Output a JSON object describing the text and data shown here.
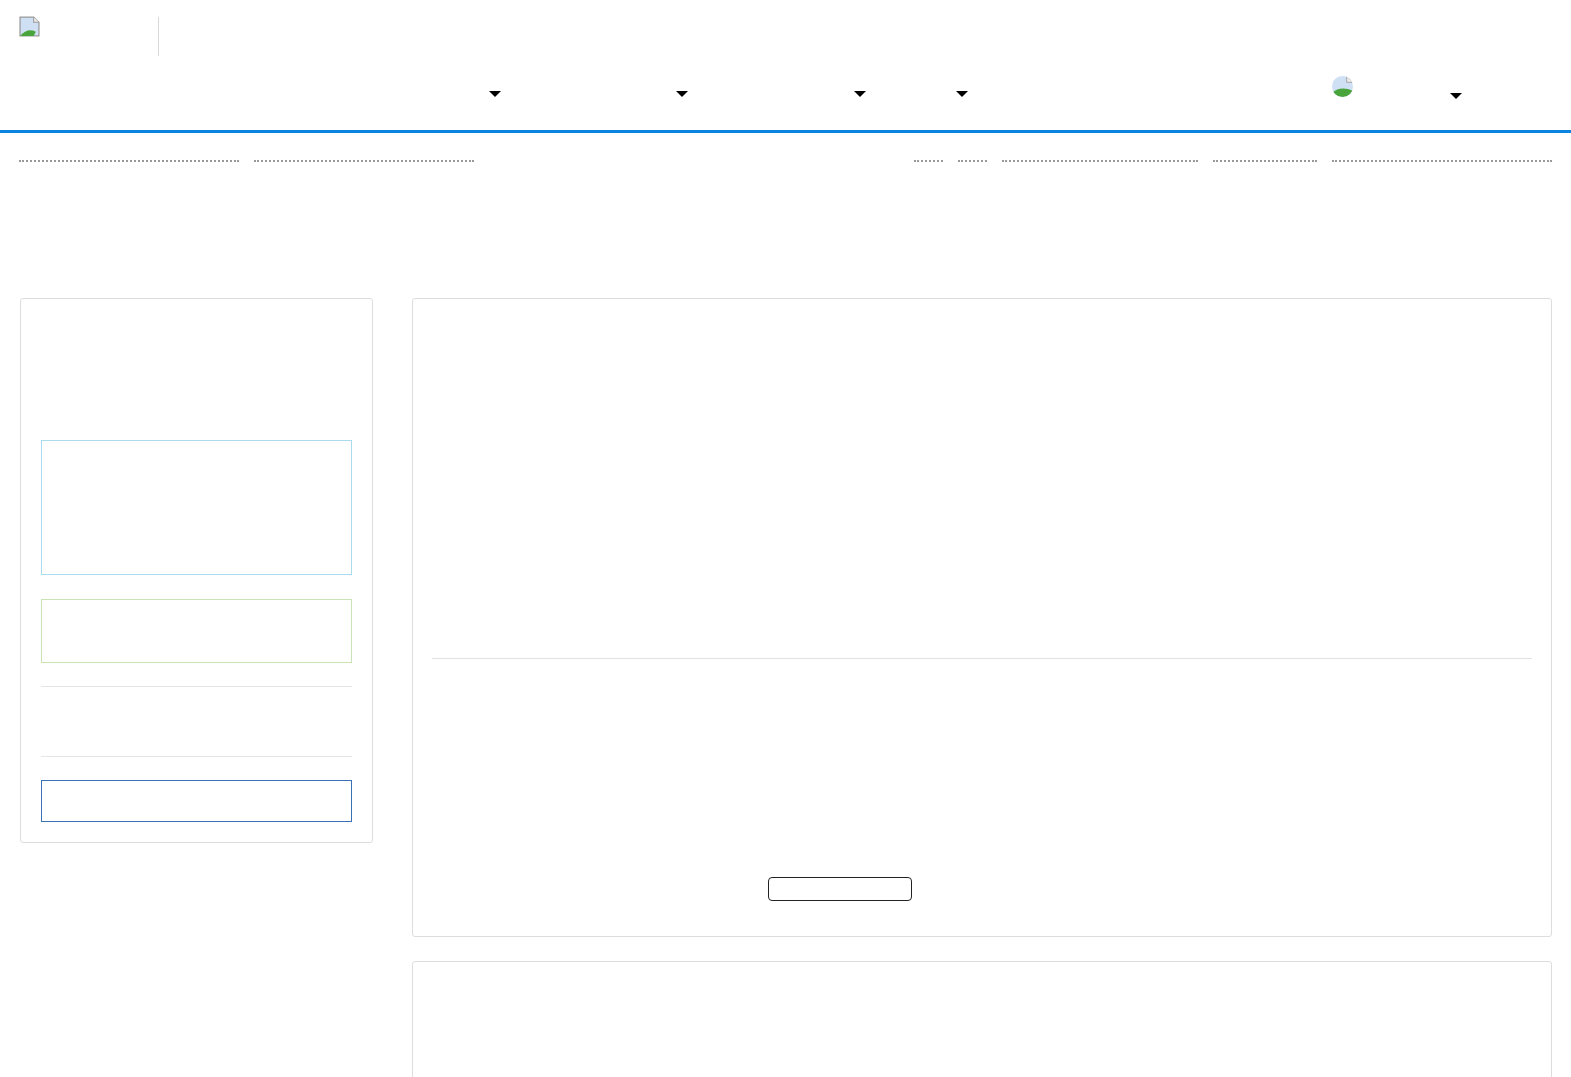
{
  "header": {
    "logo": {
      "kind": "broken-image"
    }
  },
  "nav": {
    "menus": [
      {
        "kind": "dropdown"
      },
      {
        "kind": "dropdown"
      },
      {
        "kind": "dropdown"
      },
      {
        "kind": "dropdown"
      }
    ],
    "account": {
      "kind": "dropdown"
    }
  },
  "link_bar": {
    "left": [
      {
        "kind": "long"
      },
      {
        "kind": "long"
      }
    ],
    "right": [
      {
        "kind": "short"
      },
      {
        "kind": "short"
      },
      {
        "kind": "medium"
      },
      {
        "kind": "small"
      },
      {
        "kind": "long"
      }
    ]
  },
  "sidebar": {
    "blocks": [
      {
        "kind": "info"
      },
      {
        "kind": "success"
      },
      {
        "kind": "rule"
      },
      {
        "kind": "rule"
      },
      {
        "kind": "field"
      }
    ]
  },
  "main": {
    "button": {
      "kind": "outline"
    }
  }
}
